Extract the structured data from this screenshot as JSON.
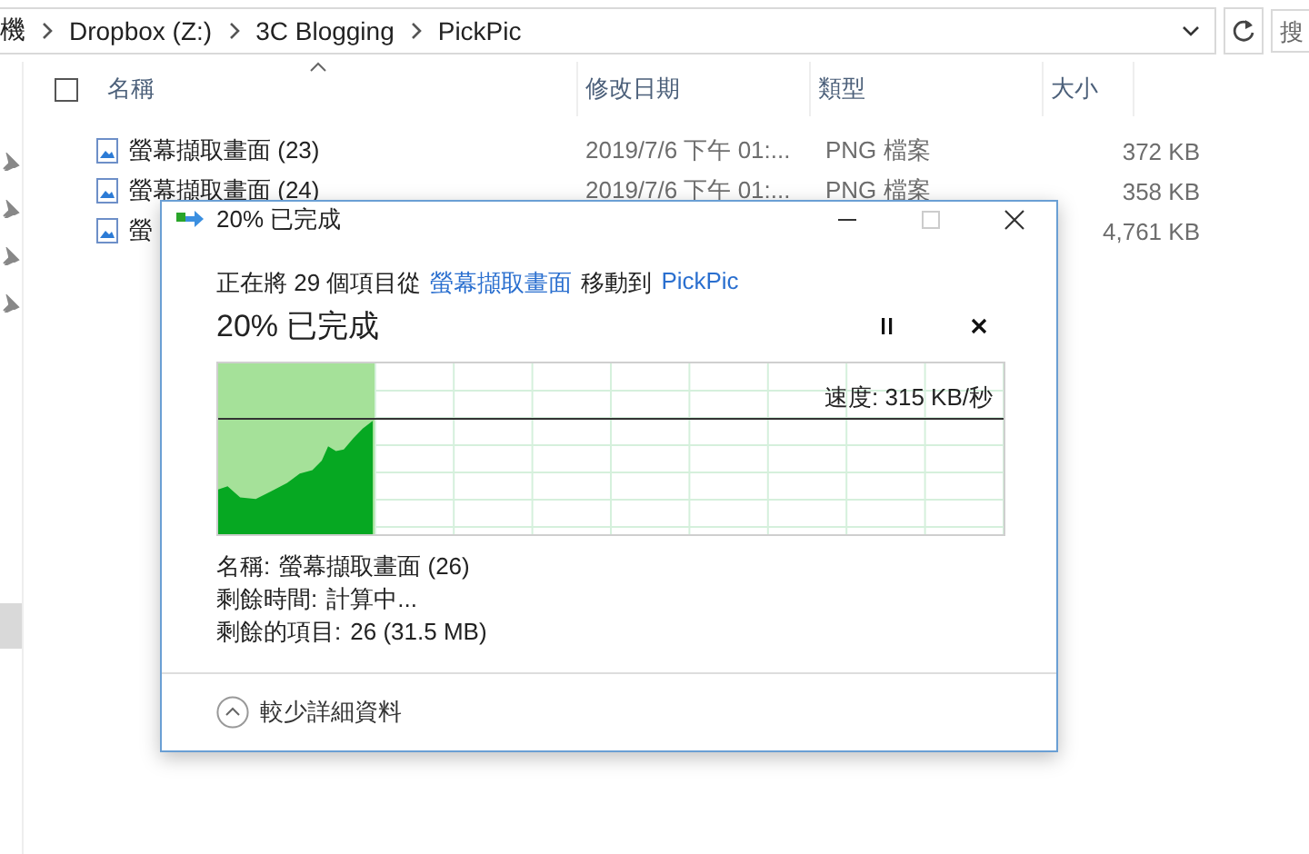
{
  "address_bar": {
    "path": [
      "機",
      "Dropbox (Z:)",
      "3C Blogging",
      "PickPic"
    ]
  },
  "search": {
    "placeholder": "搜"
  },
  "file_list": {
    "select_all": {
      "checked": false
    },
    "columns": [
      "名稱",
      "修改日期",
      "類型",
      "大小"
    ],
    "rows": [
      {
        "name": "螢幕擷取畫面 (23)",
        "date": "2019/7/6 下午 01:...",
        "type": "PNG 檔案",
        "size": "372 KB"
      },
      {
        "name": "螢幕擷取畫面 (24)",
        "date": "2019/7/6 下午 01:...",
        "type": "PNG 檔案",
        "size": "358 KB"
      },
      {
        "name": "螢",
        "size": "4,761 KB"
      }
    ]
  },
  "dialog": {
    "title": "20% 已完成",
    "message": [
      {
        "kind": "text",
        "text": "正在將 29 個項目從"
      },
      {
        "kind": "link",
        "text": "螢幕擷取畫面"
      },
      {
        "kind": "text",
        "text": "移動到"
      },
      {
        "kind": "link",
        "text": "PickPic"
      }
    ],
    "heading": "20% 已完成",
    "progress": {
      "level": 0.2,
      "speed": "速度: 315 KB/秒"
    },
    "details": [
      {
        "label": "名稱:",
        "value": "螢幕擷取畫面 (26)"
      },
      {
        "label": "剩餘時間:",
        "value": "計算中..."
      },
      {
        "label": "剩餘的項目:",
        "value": "26 (31.5 MB)"
      }
    ],
    "toggle": {
      "label": "較少詳細資料",
      "expanded": true
    }
  }
}
